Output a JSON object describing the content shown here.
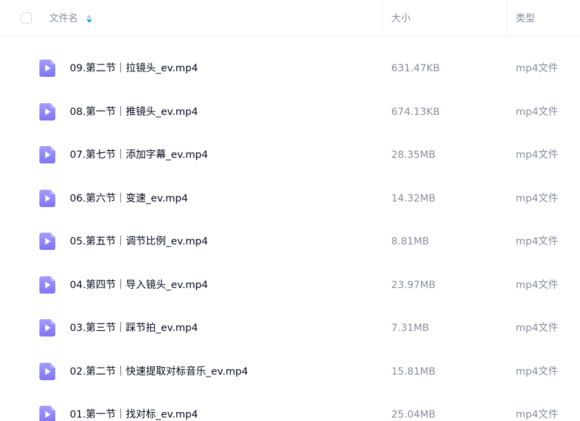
{
  "header": {
    "name_label": "文件名",
    "size_label": "大小",
    "type_label": "类型"
  },
  "colors": {
    "icon_bg": "#8f86f7",
    "sort_active": "#06a7ff"
  },
  "files": [
    {
      "name": "09.第二节｜拉镜头_ev.mp4",
      "size": "631.47KB",
      "type": "mp4文件",
      "icon": "video-file-icon"
    },
    {
      "name": "08.第一节｜推镜头_ev.mp4",
      "size": "674.13KB",
      "type": "mp4文件",
      "icon": "video-file-icon"
    },
    {
      "name": "07.第七节｜添加字幕_ev.mp4",
      "size": "28.35MB",
      "type": "mp4文件",
      "icon": "video-file-icon"
    },
    {
      "name": "06.第六节｜变速_ev.mp4",
      "size": "14.32MB",
      "type": "mp4文件",
      "icon": "video-file-icon"
    },
    {
      "name": "05.第五节｜调节比例_ev.mp4",
      "size": "8.81MB",
      "type": "mp4文件",
      "icon": "video-file-icon"
    },
    {
      "name": "04.第四节｜导入镜头_ev.mp4",
      "size": "23.97MB",
      "type": "mp4文件",
      "icon": "video-file-icon"
    },
    {
      "name": "03.第三节｜踩节拍_ev.mp4",
      "size": "7.31MB",
      "type": "mp4文件",
      "icon": "video-file-icon"
    },
    {
      "name": "02.第二节｜快速提取对标音乐_ev.mp4",
      "size": "15.81MB",
      "type": "mp4文件",
      "icon": "video-file-icon"
    },
    {
      "name": "01.第一节｜找对标_ev.mp4",
      "size": "25.04MB",
      "type": "mp4文件",
      "icon": "video-file-icon"
    }
  ]
}
